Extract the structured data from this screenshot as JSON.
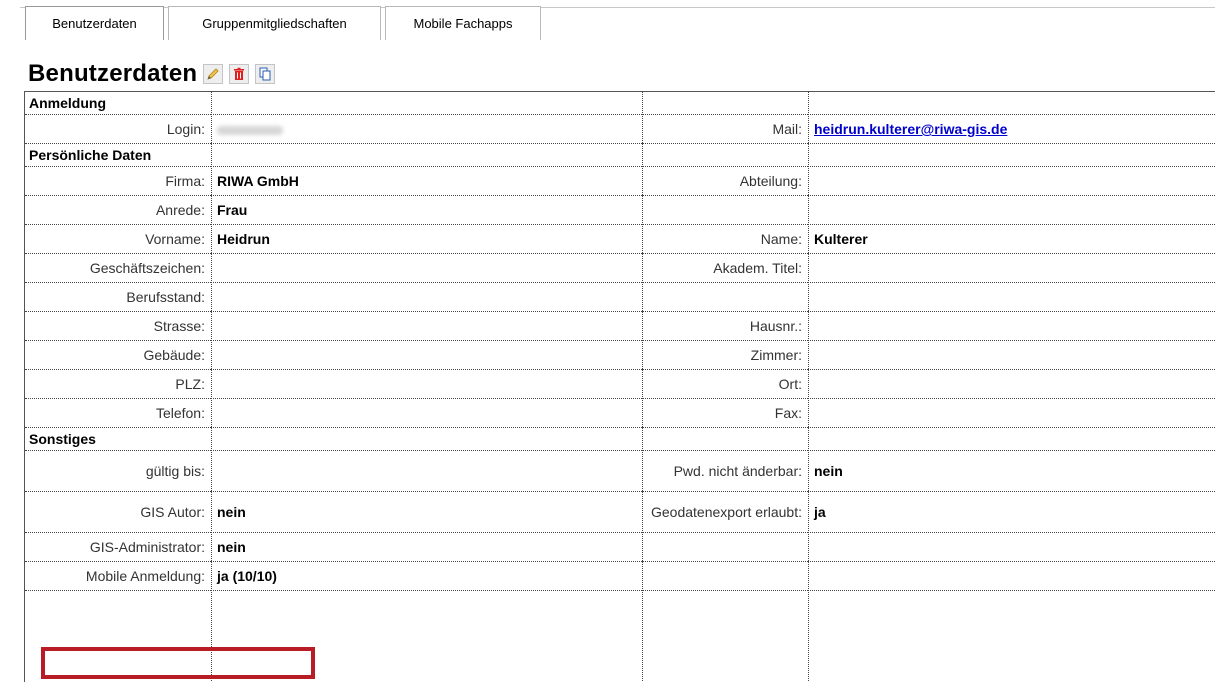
{
  "tabs": [
    {
      "label": "Benutzerdaten"
    },
    {
      "label": "Gruppenmitgliedschaften"
    },
    {
      "label": "Mobile Fachapps"
    }
  ],
  "page_title": "Benutzerdaten",
  "toolbar_icons": [
    "pencil-icon",
    "trash-icon",
    "copy-icon"
  ],
  "colors": {
    "link": "#0000cc",
    "highlight": "#b81c24",
    "delete": "#e02020",
    "pencil": "#e8b21a"
  },
  "sections": {
    "anmeldung": "Anmeldung",
    "persoenlich": "Persönliche Daten",
    "sonstiges": "Sonstiges"
  },
  "anmeldung": {
    "login_label": "Login:",
    "mail_label": "Mail:",
    "mail_value": "heidrun.kulterer@riwa-gis.de"
  },
  "persoenlich": [
    {
      "l1": "Firma:",
      "v1": "RIWA GmbH",
      "l2": "Abteilung:",
      "v2": ""
    },
    {
      "l1": "Anrede:",
      "v1": "Frau",
      "l2": "",
      "v2": ""
    },
    {
      "l1": "Vorname:",
      "v1": "Heidrun",
      "l2": "Name:",
      "v2": "Kulterer"
    },
    {
      "l1": "Geschäftszeichen:",
      "v1": "",
      "l2": "Akadem. Titel:",
      "v2": ""
    },
    {
      "l1": "Berufsstand:",
      "v1": "",
      "l2": "",
      "v2": ""
    },
    {
      "l1": "Strasse:",
      "v1": "",
      "l2": "Hausnr.:",
      "v2": ""
    },
    {
      "l1": "Gebäude:",
      "v1": "",
      "l2": "Zimmer:",
      "v2": ""
    },
    {
      "l1": "PLZ:",
      "v1": "",
      "l2": "Ort:",
      "v2": ""
    },
    {
      "l1": "Telefon:",
      "v1": "",
      "l2": "Fax:",
      "v2": ""
    }
  ],
  "sonstiges": [
    {
      "l1": "gültig bis:",
      "v1": "",
      "l2": "Pwd. nicht änderbar:",
      "v2": "nein"
    },
    {
      "l1": "GIS Autor:",
      "v1": "nein",
      "l2": "Geodatenexport erlaubt:",
      "v2": "ja"
    },
    {
      "l1": "GIS-Administrator:",
      "v1": "nein",
      "l2": "",
      "v2": ""
    },
    {
      "l1": "Mobile Anmeldung:",
      "v1": "ja (10/10)",
      "l2": "",
      "v2": ""
    }
  ]
}
